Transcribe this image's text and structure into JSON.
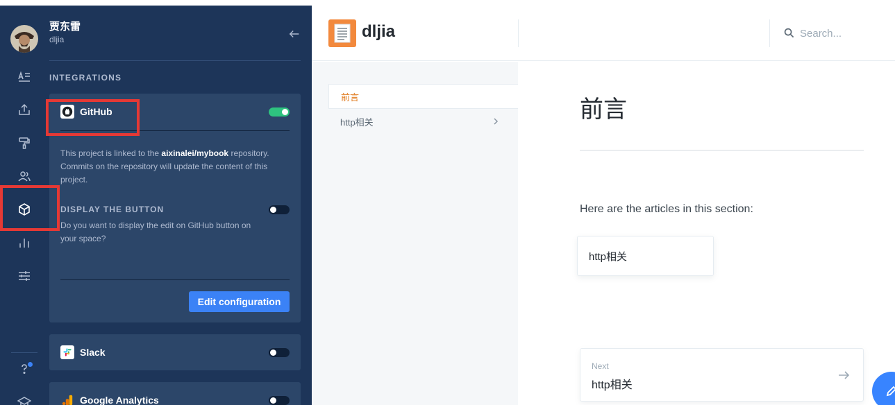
{
  "user": {
    "name": "贾东雷",
    "handle": "dljia"
  },
  "sidebar": {
    "section_title": "INTEGRATIONS",
    "rail_icons": [
      "text-icon",
      "upload-icon",
      "paint-roller-icon",
      "users-icon",
      "box-icon",
      "bar-chart-icon",
      "sliders-icon",
      "help-icon",
      "graduation-cap-icon"
    ],
    "github": {
      "name": "GitHub",
      "enabled": true,
      "desc_prefix": "This project is linked to the ",
      "repo": "aixinalei/mybook",
      "desc_suffix": " repository. Commits on the repository will update the content of this project.",
      "display_title": "DISPLAY THE BUTTON",
      "display_desc": "Do you want to display the edit on GitHub button on your space?",
      "display_enabled": false,
      "edit_label": "Edit configuration"
    },
    "slack": {
      "name": "Slack",
      "enabled": false
    },
    "google_analytics": {
      "name": "Google Analytics",
      "enabled": false
    }
  },
  "header": {
    "title": "dljia",
    "search_placeholder": "Search..."
  },
  "nav": {
    "items": [
      {
        "label": "前言",
        "active": true
      },
      {
        "label": "http相关",
        "active": false
      }
    ]
  },
  "page": {
    "title": "前言",
    "intro": "Here are the articles in this section:",
    "article": "http相关",
    "next_label": "Next",
    "next_title": "http相关"
  },
  "colors": {
    "sidebar_bg": "#1d3559",
    "card_bg": "#2c4669",
    "accent": "#3b82f6",
    "toggle_on": "#2ec37f",
    "active_nav": "#e07b1f",
    "highlight": "#e53935"
  }
}
